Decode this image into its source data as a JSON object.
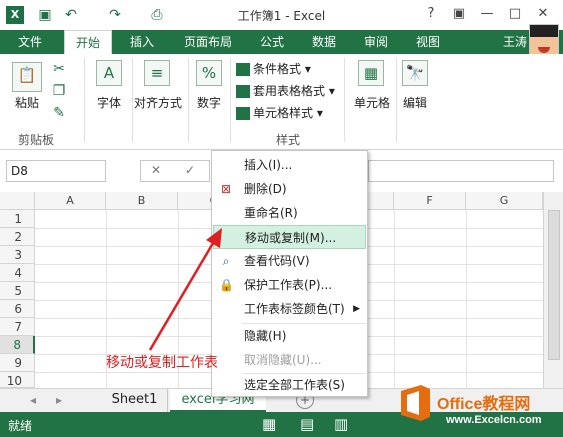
{
  "app": {
    "title": "工作簿1 - Excel",
    "logo": "X",
    "window_buttons": [
      "?",
      "▣",
      "—",
      "□",
      "✕"
    ]
  },
  "tabs": [
    "文件",
    "开始",
    "插入",
    "页面布局",
    "公式",
    "数据",
    "审阅",
    "视图"
  ],
  "active_tab": "开始",
  "user": "王涛",
  "ribbon": {
    "paste": "粘贴",
    "clipboard": "剪贴板",
    "font": "字体",
    "alignment": "对齐方式",
    "number": "数字",
    "conditional_format": "条件格式",
    "table_format": "套用表格格式",
    "cell_style": "单元格样式",
    "styles": "样式",
    "cells": "单元格",
    "editing": "编辑"
  },
  "formula_bar": {
    "name_box": "D8",
    "cancel": "✕",
    "confirm": "✓"
  },
  "columns": [
    "A",
    "B",
    "C",
    "D",
    "E",
    "F",
    "G"
  ],
  "rows": [
    "1",
    "2",
    "3",
    "4",
    "5",
    "6",
    "7",
    "8",
    "9",
    "10"
  ],
  "selected_row": "8",
  "sheets": [
    "Sheet1",
    "excel学习网"
  ],
  "add_sheet": "+",
  "status": {
    "ready": "就绪"
  },
  "context_menu": [
    {
      "label": "插入(I)...",
      "icon": ""
    },
    {
      "label": "删除(D)",
      "icon": "delete-sheet-icon"
    },
    {
      "label": "重命名(R)",
      "icon": ""
    },
    {
      "label": "移动或复制(M)...",
      "icon": "",
      "highlighted": true
    },
    {
      "label": "查看代码(V)",
      "icon": "view-code-icon"
    },
    {
      "label": "保护工作表(P)...",
      "icon": "protect-sheet-icon"
    },
    {
      "label": "工作表标签颜色(T)",
      "icon": "",
      "submenu": true
    },
    {
      "label": "隐藏(H)",
      "icon": ""
    },
    {
      "label": "取消隐藏(U)...",
      "icon": "",
      "disabled": true
    },
    {
      "label": "选定全部工作表(S)",
      "icon": ""
    }
  ],
  "annotation": "移动或复制工作表",
  "watermark": {
    "title": "Office教程网",
    "subtitle": "www.Excelcn.com"
  },
  "colors": {
    "brand": "#217346",
    "annotation": "#e02020",
    "highlight": "#d3f0e0"
  }
}
